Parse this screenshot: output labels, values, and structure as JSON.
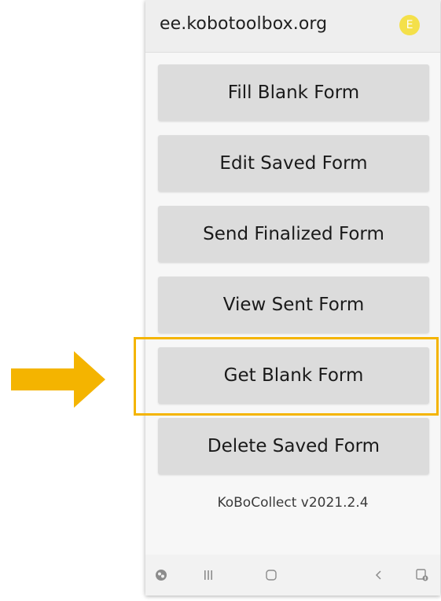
{
  "header": {
    "server_url": "ee.kobotoolbox.org",
    "avatar_letter": "E"
  },
  "menu": {
    "items": [
      {
        "label": "Fill Blank Form"
      },
      {
        "label": "Edit Saved Form"
      },
      {
        "label": "Send Finalized Form"
      },
      {
        "label": "View Sent Form"
      },
      {
        "label": "Get Blank Form"
      },
      {
        "label": "Delete Saved Form"
      }
    ]
  },
  "footer": {
    "version": "KoBoCollect v2021.2.4"
  },
  "navbar": {
    "icons": [
      "assistant-icon",
      "recent-apps-icon",
      "home-icon",
      "back-icon",
      "screenshot-icon"
    ]
  },
  "annotation": {
    "color": "#f4b400",
    "highlighted_item": "Get Blank Form"
  },
  "colors": {
    "button_bg": "#dcdcdc",
    "avatar_bg": "#f4e04a",
    "topbar_bg": "#eeeeee"
  }
}
